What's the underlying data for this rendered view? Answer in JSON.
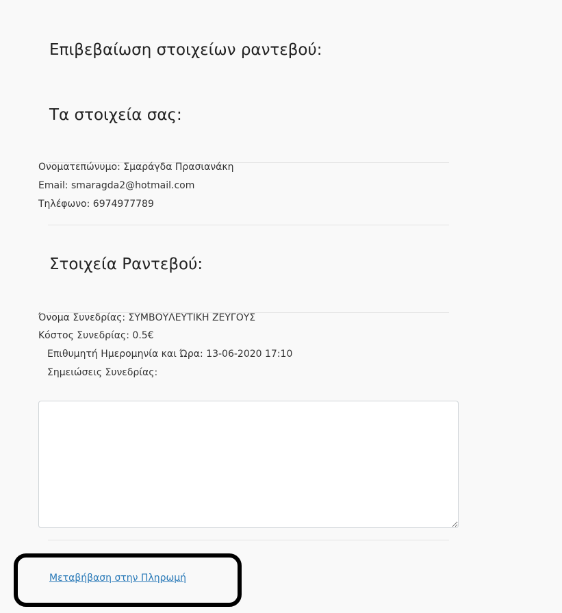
{
  "headings": {
    "confirm": "Επιβεβαίωση στοιχείων ραντεβού:",
    "your_details": "Τα στοιχεία σας:",
    "appointment_details": "Στοιχεία Ραντεβού:"
  },
  "user": {
    "name": "Ονοματεπώνυμο: Σμαράγδα Πρασιανάκη",
    "email": "Email: smaragda2@hotmail.com",
    "phone": "Τηλέφωνο: 6974977789"
  },
  "appointment": {
    "session_name": "Όνομα Συνεδρίας: ΣΥΜΒΟΥΛΕΥΤΙΚΗ ΖΕΥΓΟΥΣ",
    "session_cost": "Κόστος Συνεδρίας: 0.5€",
    "desired_datetime": "Επιθυμητή Ημερομηνία και Ώρα: 13-06-2020 17:10",
    "notes_label": "Σημειώσεις Συνεδρίας:",
    "notes_value": ""
  },
  "actions": {
    "payment_link": "Μεταβήβαση στην Πληρωμή"
  }
}
